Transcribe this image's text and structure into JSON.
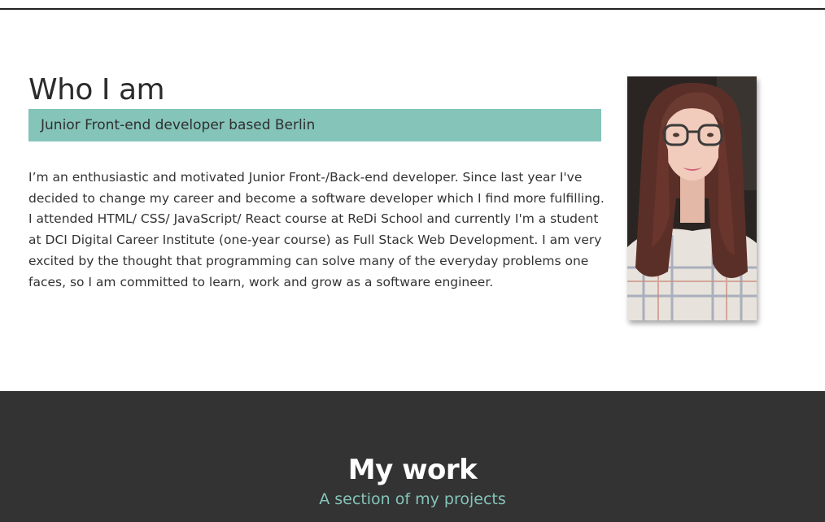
{
  "about": {
    "title": "Who I am",
    "tagline": "Junior Front-end developer based Berlin",
    "bio": "I’m an enthusiastic and motivated Junior Front-/Back-end developer. Since last year I've decided to change my career and become a software developer which I find more fulfilling. I attended HTML/ CSS/ JavaScript/ React course at ReDi School and currently I'm a student at DCI Digital Career Institute (one-year course) as Full Stack Web Development. I am very excited by the thought that programming can solve many of the everyday problems one faces, so I am committed to learn, work and grow as a software engineer.",
    "portrait_icon": "profile-photo"
  },
  "work": {
    "title": "My work",
    "subtitle": "A section of my projects"
  },
  "colors": {
    "accent": "#85c4b9",
    "dark_section": "#333333",
    "text": "#303030"
  }
}
